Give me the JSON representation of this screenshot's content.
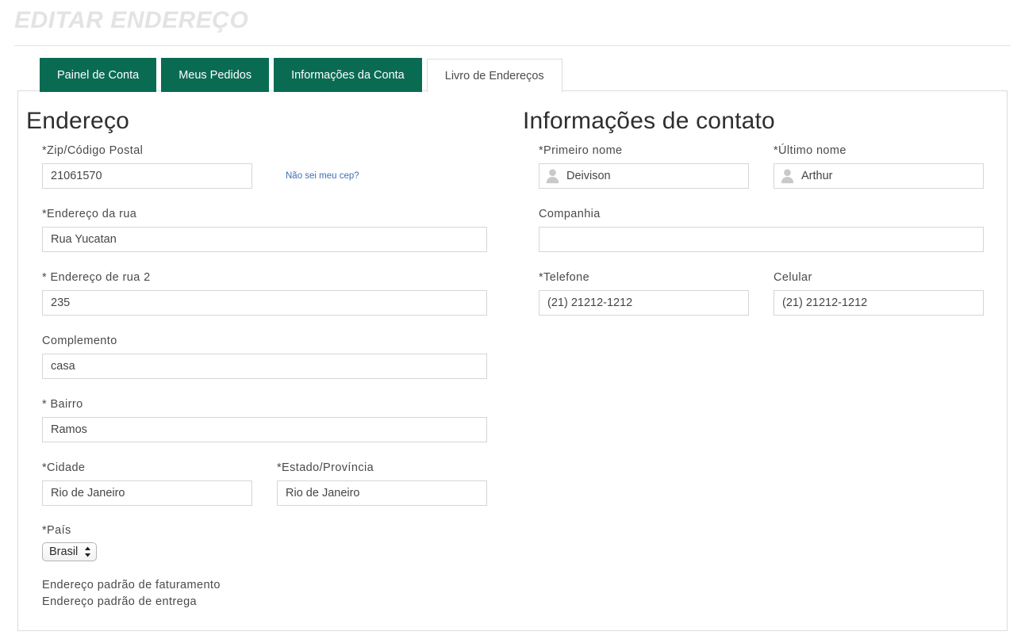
{
  "header": {
    "title": "EDITAR ENDEREÇO"
  },
  "tabs": [
    {
      "label": "Painel de Conta",
      "active": false
    },
    {
      "label": "Meus Pedidos",
      "active": false
    },
    {
      "label": "Informações da Conta",
      "active": false
    },
    {
      "label": "Livro de Endereços",
      "active": true
    }
  ],
  "address": {
    "heading": "Endereço",
    "zip_label": "*Zip/Código Postal",
    "zip_value": "21061570",
    "zip_hint_link": "Não sei meu cep?",
    "street_label": "*Endereço da rua",
    "street_value": "Rua Yucatan",
    "street2_label": "* Endereço de rua 2",
    "street2_value": "235",
    "complement_label": "Complemento",
    "complement_value": "casa",
    "district_label": "* Bairro",
    "district_value": "Ramos",
    "city_label": "*Cidade",
    "city_value": "Rio de Janeiro",
    "state_label": "*Estado/Província",
    "state_value": "Rio de Janeiro",
    "country_label": "*País",
    "country_value": "Brasil",
    "default_billing": "Endereço padrão de faturamento",
    "default_shipping": "Endereço padrão de entrega"
  },
  "contact": {
    "heading": "Informações de contato",
    "first_name_label": "*Primeiro nome",
    "first_name_value": "Deivison",
    "last_name_label": "*Último nome",
    "last_name_value": "Arthur",
    "company_label": "Companhia",
    "company_value": "",
    "company_placeholder": "",
    "phone_label": "*Telefone",
    "phone_value": "(21) 21212-1212",
    "mobile_label": "Celular",
    "mobile_value": "(21) 21212-1212"
  },
  "colors": {
    "tab_active_bg": "#ffffff",
    "tab_inactive_bg": "#0a6b53",
    "tab_inactive_text": "#ffffff",
    "title_text": "#e3e3e3",
    "link": "#3f6fb5",
    "border": "#d6d6d6",
    "panel_border": "#dcdcdc"
  }
}
